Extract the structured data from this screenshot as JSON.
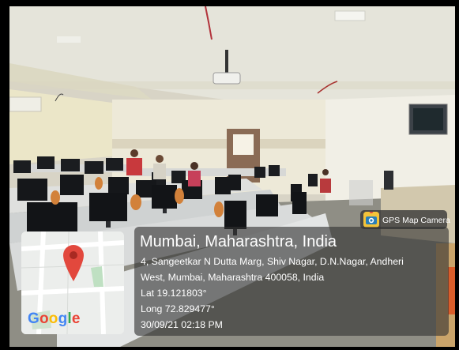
{
  "photo": {
    "description_colors": {
      "ceiling": "#e4e3d9",
      "wall": "#ece8d6",
      "desk": "#dfe1e0",
      "floor": "#8f8e84",
      "monitor": "#1b1d20"
    }
  },
  "badge": {
    "label": "GPS Map Camera",
    "icon": "gps-map-camera-icon"
  },
  "location": {
    "title": "Mumbai, Maharashtra, India",
    "address_line1": "4, Sangeetkar N Dutta Marg, Shiv Nagar, D.N.Nagar, Andheri",
    "address_line2": "West, Mumbai, Maharashtra 400058, India",
    "lat": "Lat 19.121803°",
    "long": "Long 72.829477°",
    "timestamp": "30/09/21 02:18 PM"
  },
  "map": {
    "logo_text": "Google",
    "logo_letters": [
      {
        "char": "G",
        "color": "#4285F4"
      },
      {
        "char": "o",
        "color": "#EA4335"
      },
      {
        "char": "o",
        "color": "#FBBC05"
      },
      {
        "char": "g",
        "color": "#4285F4"
      },
      {
        "char": "l",
        "color": "#34A853"
      },
      {
        "char": "e",
        "color": "#EA4335"
      }
    ],
    "pin_color": "#e2483d",
    "pin_icon": "location-pin-icon"
  }
}
